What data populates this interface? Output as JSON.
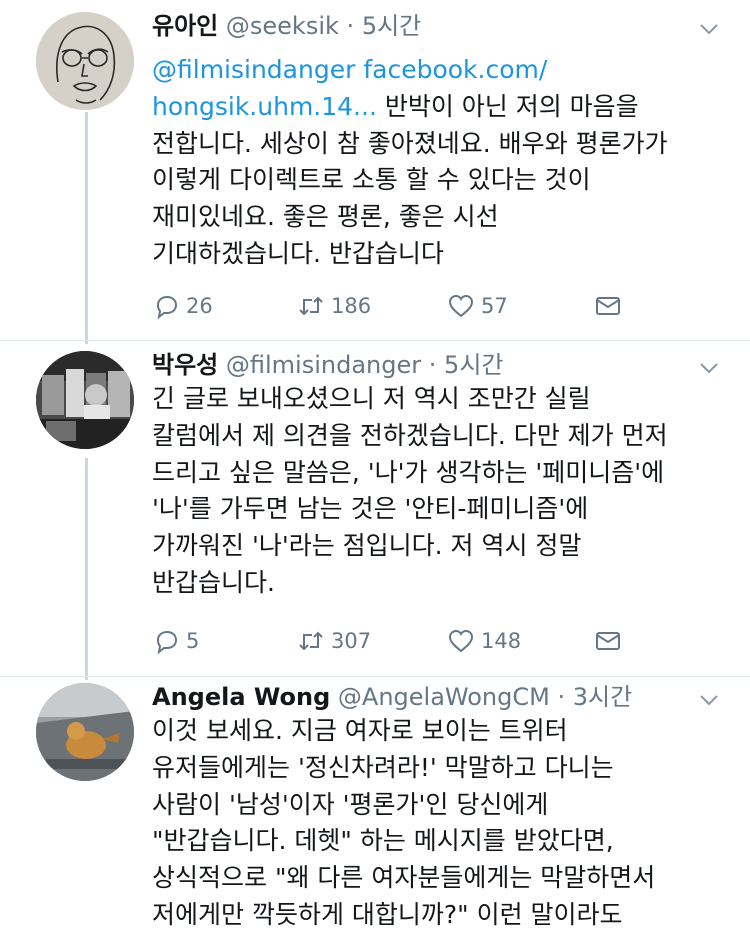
{
  "tweets": [
    {
      "name": "유아인",
      "handle": "@seeksik",
      "dot": "·",
      "time": "5시간",
      "mention": "@filmisindanger",
      "link": "facebook.com/\nhongsik.uhm.14...",
      "text": " 반박이 아닌 저의 마음을\n전합니다. 세상이 참 좋아졌네요. 배우와 평론가가\n이렇게 다이렉트로 소통 할 수 있다는 것이\n재미있네요. 좋은 평론, 좋은 시선\n기대하겠습니다. 반갑습니다",
      "replies": "26",
      "retweets": "186",
      "likes": "57"
    },
    {
      "name": "박우성",
      "handle": "@filmisindanger",
      "dot": "·",
      "time": "5시간",
      "text": "긴 글로 보내오셨으니 저 역시 조만간 실릴\n칼럼에서 제 의견을 전하겠습니다. 다만 제가 먼저\n드리고 싶은 말씀은, '나'가 생각하는 '페미니즘'에\n'나'를 가두면 남는 것은 '안티-페미니즘'에\n가까워진 '나'라는 점입니다. 저 역시 정말\n반갑습니다.",
      "replies": "5",
      "retweets": "307",
      "likes": "148"
    },
    {
      "name": "Angela Wong",
      "handle": "@AngelaWongCM",
      "dot": "·",
      "time": "3시간",
      "text": "이것 보세요. 지금 여자로 보이는 트위터\n유저들에게는 '정신차려라!' 막말하고 다니는\n사람이 '남성'이자 '평론가'인 당신에게\n\"반갑습니다. 데헷\" 하는 메시지를 받았다면,\n상식적으로 \"왜 다른 여자분들에게는 막말하면서\n저에게만 깍듯하게 대합니까?\" 이런 말이라도"
    }
  ],
  "icons": {
    "reply": "reply-icon",
    "retweet": "retweet-icon",
    "like": "heart-icon",
    "dm": "envelope-icon",
    "caret": "chevron-down-icon"
  },
  "colors": {
    "link": "#1b95e0",
    "secondary_text": "#657786",
    "thread_line": "#ccd6dd"
  }
}
